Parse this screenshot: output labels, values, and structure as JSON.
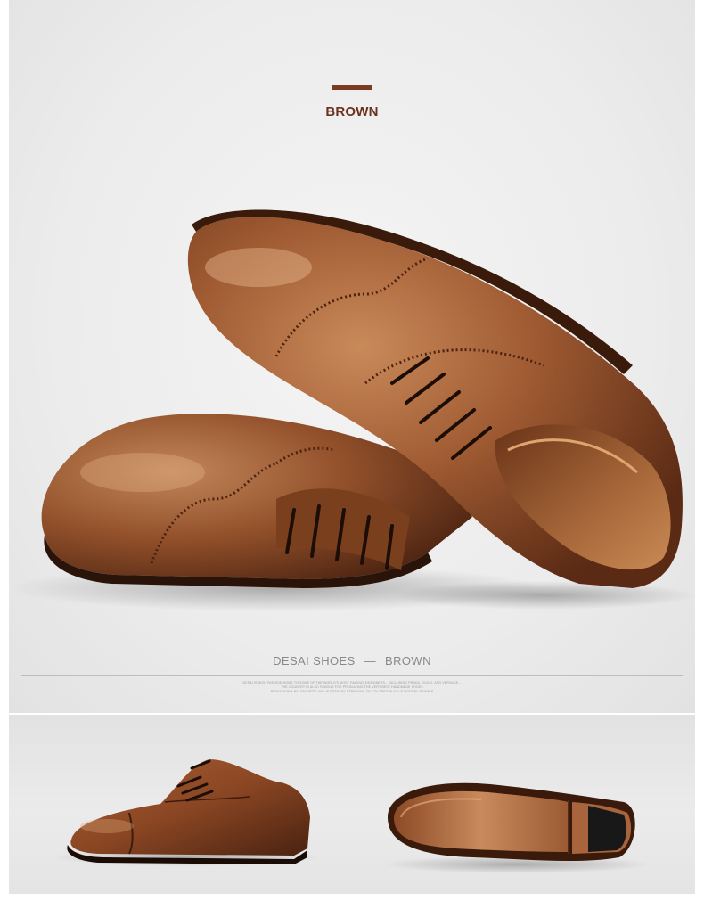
{
  "hero": {
    "title": "BROWN",
    "caption_brand": "DESAI SHOES",
    "caption_dash": "—",
    "caption_color": "BROWN",
    "accent_color": "#7b3a22",
    "fineprint": [
      "DESAI IS HIGH FASHION HOME TO SOME OF THE WORLD'S MOST FAMOUS DESIGNERS... INCLUDING PRADA, GUCCI, AND VERSACE...",
      "THE COUNTRY IS ALSO FAMOUS FOR PRODUCING THE VERY BEST HANDMADE SHOES",
      "RIGHT NOW A BIG FAVORITE AND IS DESAI BY STRINGING OF COLORED PLAID IS DOTS BY FRAMES"
    ]
  },
  "products": {
    "main_image": "brown-brogue-oxford-pair",
    "side_view": "brown-cap-toe-oxford-side-view",
    "sole_view": "leather-sole-bottom-view"
  }
}
